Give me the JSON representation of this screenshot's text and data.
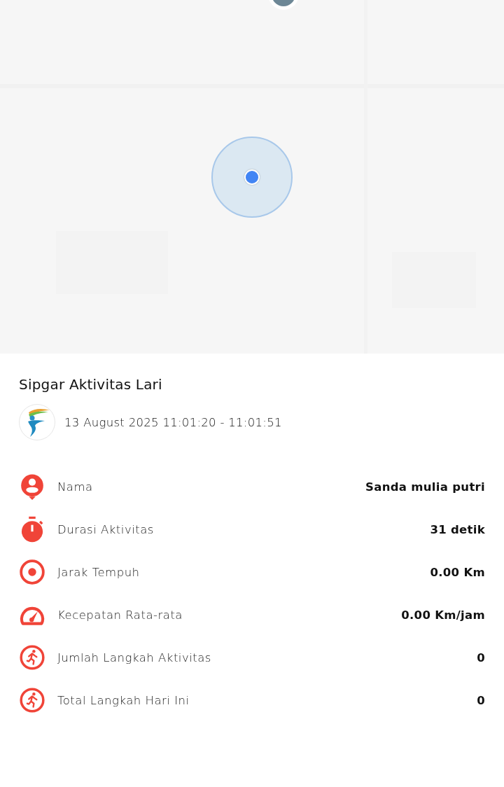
{
  "title": "Sipgar Aktivitas Lari",
  "session": {
    "datetime": "13 August 2025 11:01:20 - 11:01:51"
  },
  "stats": [
    {
      "kind": "person",
      "label": "Nama",
      "value": "Sanda mulia putri"
    },
    {
      "kind": "stopwatch",
      "label": "Durasi Aktivitas",
      "value": "31 detik"
    },
    {
      "kind": "target",
      "label": "Jarak Tempuh",
      "value": "0.00 Km"
    },
    {
      "kind": "speedometer",
      "label": "Kecepatan Rata-rata",
      "value": "0.00 Km/jam"
    },
    {
      "kind": "runner",
      "label": "Jumlah Langkah Aktivitas",
      "value": "0"
    },
    {
      "kind": "runner",
      "label": "Total Langkah Hari Ini",
      "value": "0"
    }
  ]
}
